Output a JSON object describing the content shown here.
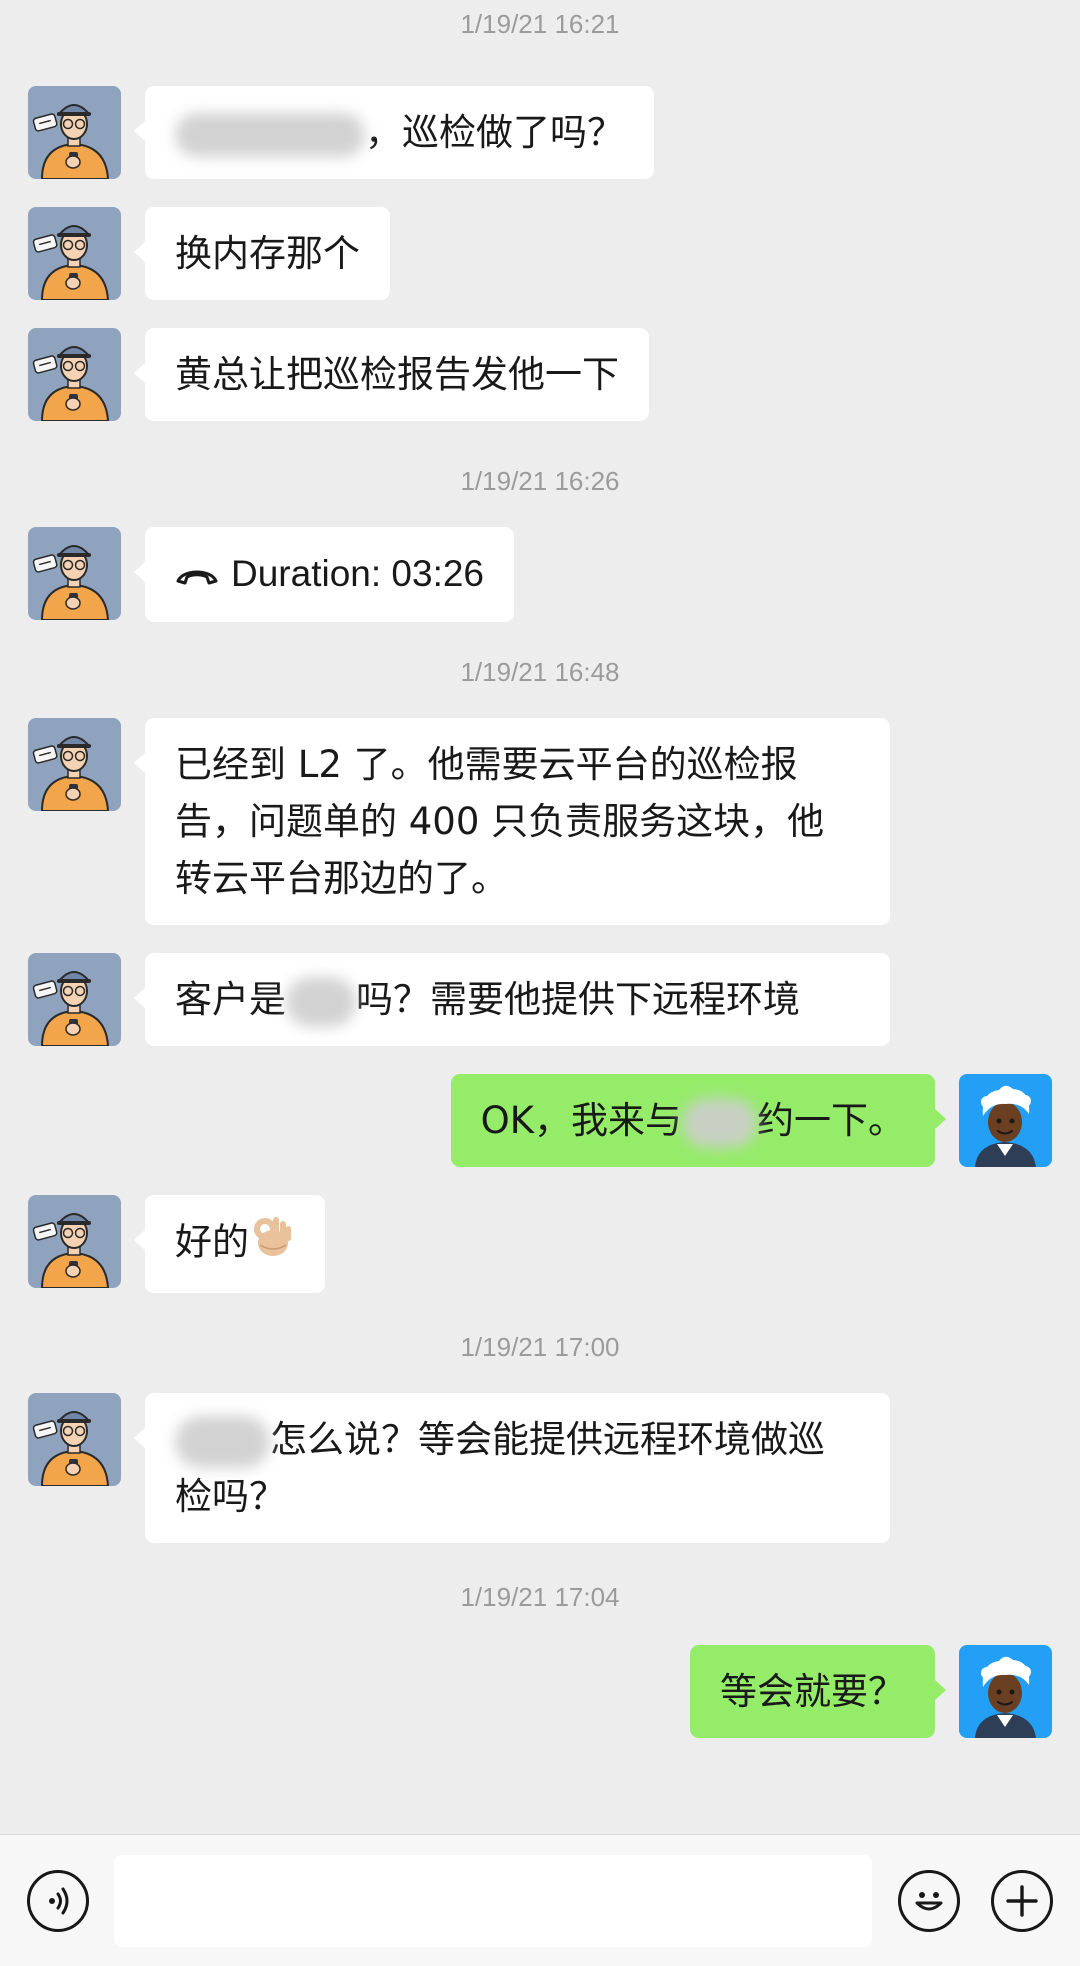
{
  "timestamps": {
    "t1": "1/19/21 16:21",
    "t2": "1/19/21 16:26",
    "t3": "1/19/21 16:48",
    "t4": "1/19/21 17:00",
    "t5": "1/19/21 17:04"
  },
  "messages": {
    "m1_text": "，巡检做了吗？",
    "m2_text": "换内存那个",
    "m3_text": "黄总让把巡检报告发他一下",
    "m4_text": "Duration: 03:26",
    "m5_text": "已经到 L2 了。他需要云平台的巡检报告，问题单的 400 只负责服务这块，他转云平台那边的了。",
    "m6_a": "客户是",
    "m6_b": "吗？需要他提供下远程环境",
    "m7_a": "OK，我来与",
    "m7_b": "约一下。",
    "m8_text": "好的",
    "m9_a": "怎么说？等会能提供远程环境做巡检吗？",
    "m10_text": "等会就要？"
  },
  "icons": {
    "contact_avatar": "cartoon-man-with-phone-avatar",
    "self_avatar": "white-haired-person-avatar",
    "call": "phone-handset-icon",
    "ok_emoji": "ok-hand-emoji",
    "voice": "voice-input-icon",
    "emoji_btn": "smiley-icon",
    "more_btn": "plus-icon"
  },
  "colors": {
    "background": "#ededed",
    "incoming_bubble": "#ffffff",
    "outgoing_bubble": "#95ec69",
    "timestamp": "#9b9b9b"
  }
}
